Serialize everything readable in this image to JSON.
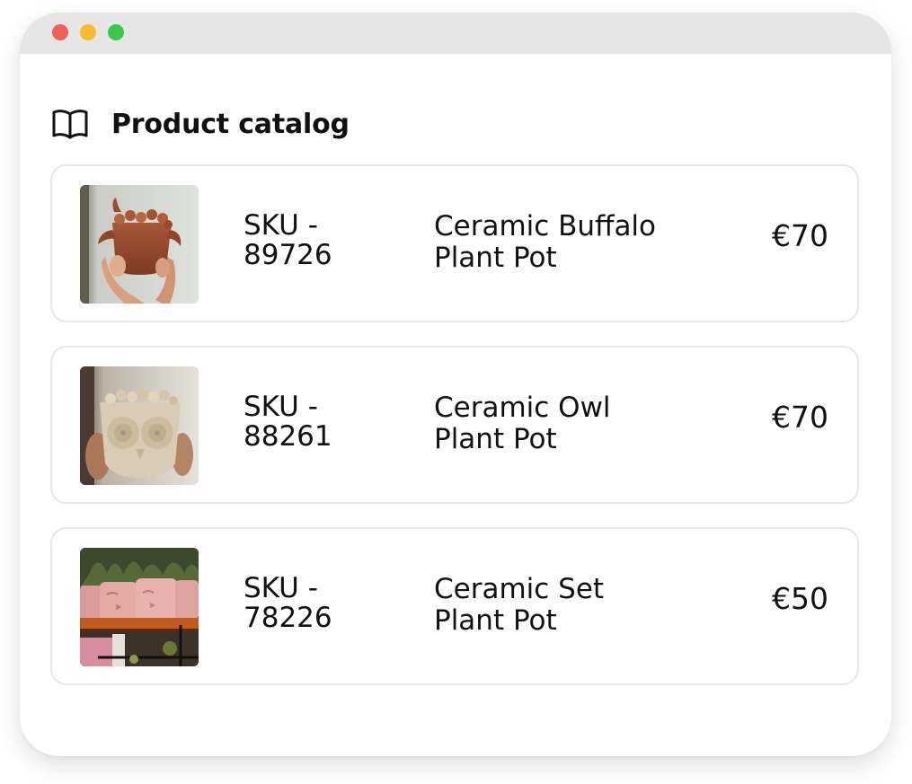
{
  "window": {
    "controls": {
      "close_color": "#f25f58",
      "minimize_color": "#fbbd2e",
      "zoom_color": "#3bc84a"
    }
  },
  "header": {
    "icon": "book-open-icon",
    "title": "Product catalog"
  },
  "products": [
    {
      "sku_line1": "SKU -",
      "sku_line2": "89726",
      "name_line1": "Ceramic Buffalo",
      "name_line2": "Plant Pot",
      "price": "€70",
      "image": "terracotta-buffalo-pot-photo"
    },
    {
      "sku_line1": "SKU -",
      "sku_line2": "88261",
      "name_line1": "Ceramic Owl",
      "name_line2": "Plant Pot",
      "price": "€70",
      "image": "beige-owl-pot-photo"
    },
    {
      "sku_line1": "SKU -",
      "sku_line2": "78226",
      "name_line1": "Ceramic Set",
      "name_line2": "Plant Pot",
      "price": "€50",
      "image": "pink-face-pots-shelf-photo"
    }
  ]
}
